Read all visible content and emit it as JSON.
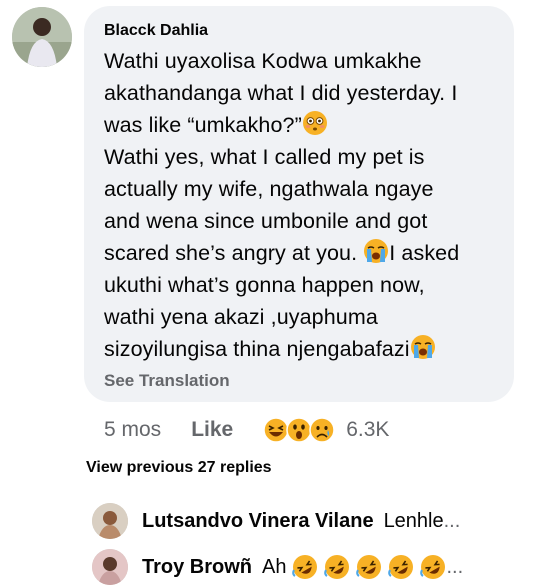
{
  "comment": {
    "author": "Blacck Dahlia",
    "line1": "Wathi uyaxolisa Kodwa umkakhe",
    "line2": "akathandanga what I did yesterday. I",
    "line3": "was like “umkakho?”",
    "line4": "Wathi yes, what I called my pet is",
    "line5": "actually my wife, ngathwala ngaye",
    "line6": "and wena since umbonile and got",
    "line7a": "scared she’s angry at you. ",
    "line7b": "I asked",
    "line8": "ukuthi what’s gonna happen now,",
    "line9": "wathi yena akazi ,uyaphuma",
    "line10": "sizoyilungisa thina njengabafazi",
    "see_translation": "See Translation"
  },
  "actions": {
    "time": "5 mos",
    "like": "Like",
    "reaction_count": "6.3K",
    "reaction_icons": [
      "laughing-emoji",
      "surprised-emoji",
      "sad-emoji"
    ]
  },
  "view_previous": "View previous 27 replies",
  "replies": [
    {
      "name": "Lutsandvo Vinera Vilane",
      "text": "Lenhle",
      "ellipsis": "..."
    },
    {
      "name": "Troy Browñ",
      "text": "Ah",
      "ellipsis": "..."
    }
  ],
  "colors": {
    "bubble": "#f0f2f5",
    "secondary_text": "#65676b",
    "emoji_yellow": "#f7b125"
  }
}
